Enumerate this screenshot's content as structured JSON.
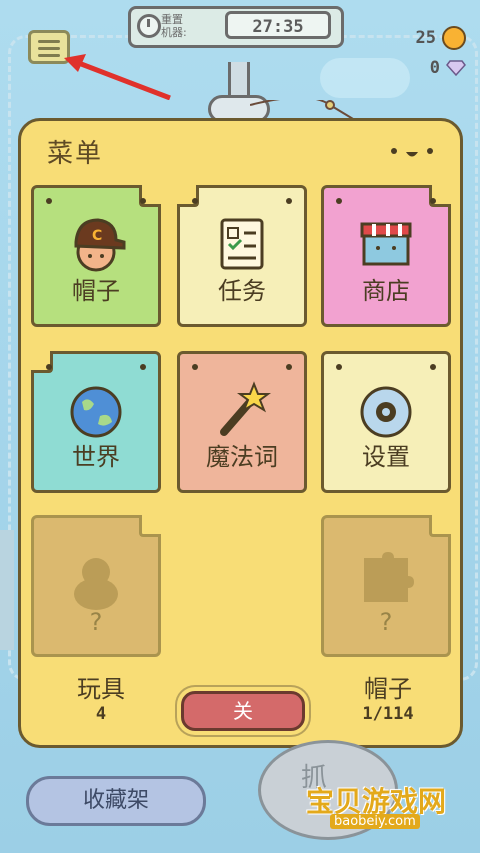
{
  "timer": {
    "label": "重置\n机器:",
    "value": "27:35"
  },
  "currency": {
    "coins": "25",
    "gems": "0"
  },
  "menu": {
    "title": "菜单",
    "cards": [
      {
        "label": "帽子",
        "color": "#b6e07e",
        "icon": "cap-face-icon"
      },
      {
        "label": "任务",
        "color": "#f6efb8",
        "icon": "checklist-icon"
      },
      {
        "label": "商店",
        "color": "#f2a2d0",
        "icon": "shop-icon"
      },
      {
        "label": "世界",
        "color": "#8fdcd3",
        "icon": "globe-icon"
      },
      {
        "label": "魔法词",
        "color": "#efb59b",
        "icon": "magic-wand-icon"
      },
      {
        "label": "设置",
        "color": "#f6efb8",
        "icon": "gear-icon"
      },
      {
        "label": "?",
        "color": "#c49c6a",
        "icon": "toy-silhouette-icon"
      },
      {
        "label": "?",
        "color": "#c49c6a",
        "icon": "puzzle-icon"
      }
    ],
    "toys_label": "玩具",
    "toys_count": "4",
    "hats_label": "帽子",
    "hats_count": "1/114",
    "close_label": "关"
  },
  "bottom": {
    "collection_label": "收藏架",
    "grab_label": "抓"
  },
  "watermark": {
    "text": "宝贝游戏网",
    "url": "baobeiy.com"
  }
}
